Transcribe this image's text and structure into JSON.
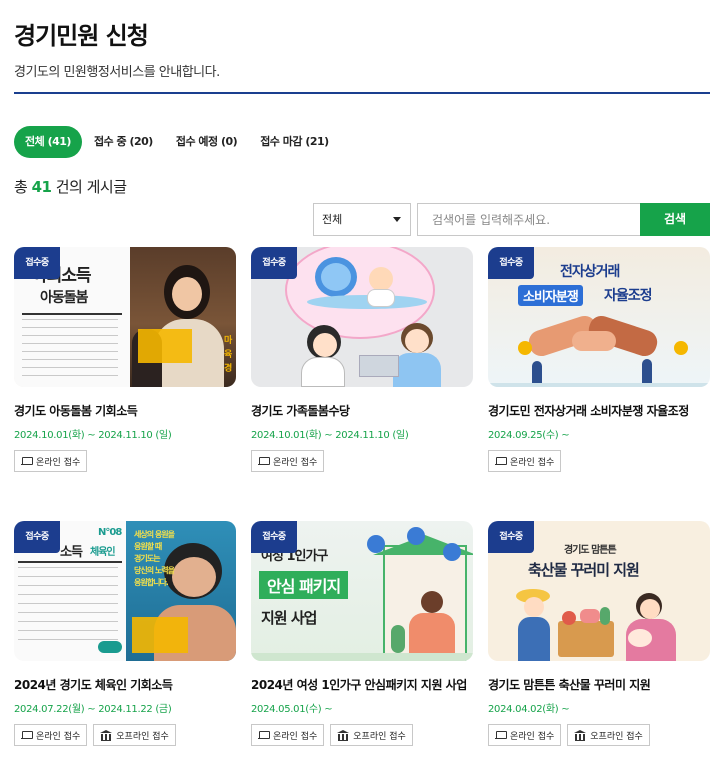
{
  "header": {
    "title": "경기민원 신청",
    "description": "경기도의 민원행정서비스를 안내합니다."
  },
  "tabs": [
    {
      "label": "전체 (41)",
      "active": true
    },
    {
      "label": "접수 중 (20)",
      "active": false
    },
    {
      "label": "접수 예정 (0)",
      "active": false
    },
    {
      "label": "접수 마감 (21)",
      "active": false
    }
  ],
  "summary": {
    "prefix": "총",
    "count": "41",
    "suffix": "건의 게시글"
  },
  "search": {
    "select_value": "전체",
    "placeholder": "검색어를 입력해주세요.",
    "button_label": "검색"
  },
  "cards": [
    {
      "badge": "접수중",
      "title": "경기도 아동돌봄 기회소득",
      "date": "2024.10.01(화) ~ 2024.11.10 (일)",
      "buttons": [
        "온라인 접수"
      ],
      "thumb_text": [
        "아회소득",
        "아동돌봄",
        "마",
        "육",
        "경"
      ]
    },
    {
      "badge": "접수중",
      "title": "경기도 가족돌봄수당",
      "date": "2024.10.01(화) ~ 2024.11.10 (일)",
      "buttons": [
        "온라인 접수"
      ]
    },
    {
      "badge": "접수중",
      "title": "경기도민 전자상거래 소비자분쟁 자율조정",
      "date": "2024.09.25(수) ~",
      "buttons": [
        "온라인 접수"
      ],
      "thumb_text": [
        "전자상거래",
        "소비자분쟁",
        "자율조정"
      ]
    },
    {
      "badge": "접수중",
      "title": "2024년 경기도 체육인 기회소득",
      "date": "2024.07.22(월) ~ 2024.11.22 (금)",
      "buttons": [
        "온라인 접수",
        "오프라인 접수"
      ],
      "thumb_text": [
        "N°08",
        "소득",
        "체육인",
        "세상의 응원을",
        "응원할 때",
        "경기도는",
        "당신의 노력을",
        "응원합니다."
      ]
    },
    {
      "badge": "접수중",
      "title": "2024년 여성 1인가구 안심패키지 지원 사업",
      "date": "2024.05.01(수) ~",
      "buttons": [
        "온라인 접수",
        "오프라인 접수"
      ],
      "thumb_text": [
        "여성 1인가구",
        "안심 패키지",
        "지원 사업"
      ]
    },
    {
      "badge": "접수중",
      "title": "경기도 맘튼튼 축산물 꾸러미 지원",
      "date": "2024.04.02(화) ~",
      "buttons": [
        "온라인 접수",
        "오프라인 접수"
      ],
      "thumb_text": [
        "경기도 맘튼튼",
        "축산물 꾸러미 지원"
      ]
    }
  ],
  "colors": {
    "accent_green": "#16a34a",
    "badge_navy": "#1c3d8e",
    "title_rule": "#1a3f8f"
  }
}
